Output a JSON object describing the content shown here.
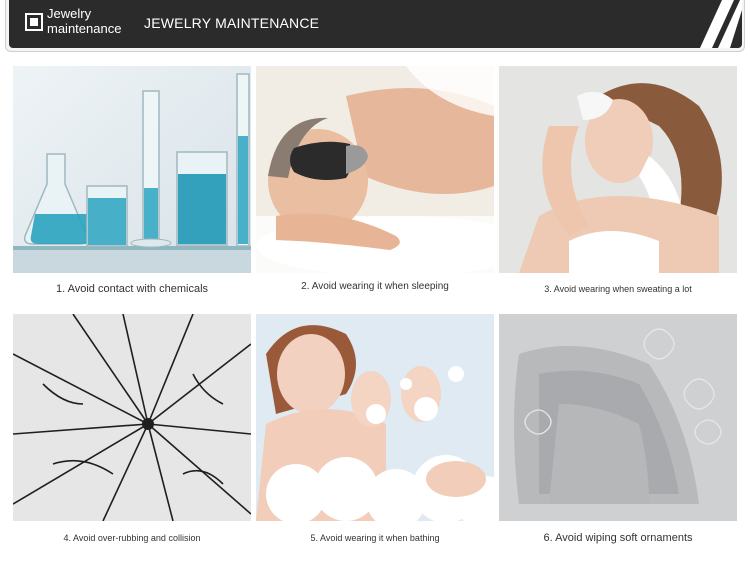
{
  "header": {
    "small_title": "Jewelry maintenance",
    "title": "JEWELRY MAINTENANCE"
  },
  "tips": [
    {
      "caption": "1. Avoid contact with chemicals",
      "icon": "lab-glassware-photo"
    },
    {
      "caption": "2. Avoid wearing it when sleeping",
      "icon": "sleeping-person-photo"
    },
    {
      "caption": "3. Avoid wearing when sweating a lot",
      "icon": "sweating-person-photo"
    },
    {
      "caption": "4. Avoid over-rubbing and collision",
      "icon": "cracked-glass-photo"
    },
    {
      "caption": "5. Avoid wearing it when bathing",
      "icon": "bubble-bath-photo"
    },
    {
      "caption": "6. Avoid wiping soft ornaments",
      "icon": "cleaning-cloth-photo"
    }
  ],
  "colors": {
    "banner": "#2b2b2b",
    "liquid": "#2aa3bf",
    "caption": "#333333"
  }
}
